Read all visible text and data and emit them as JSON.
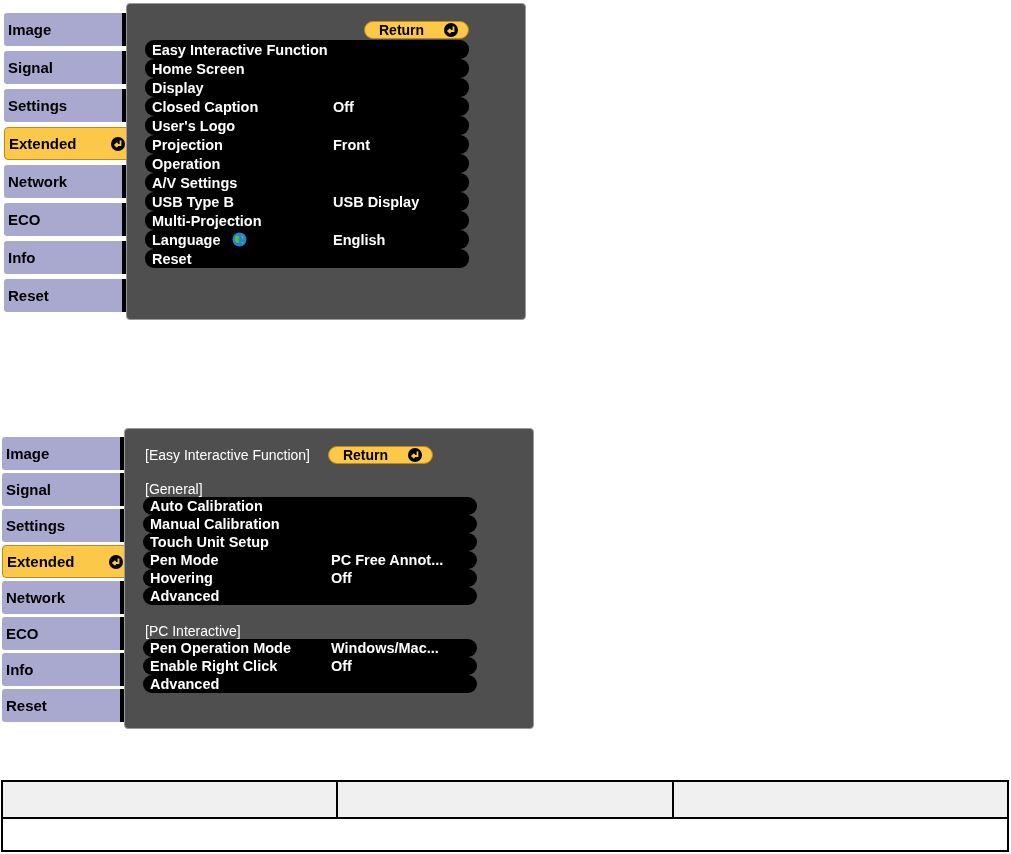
{
  "menus": [
    {
      "sidebar": [
        {
          "label": "Image",
          "selected": false
        },
        {
          "label": "Signal",
          "selected": false
        },
        {
          "label": "Settings",
          "selected": false
        },
        {
          "label": "Extended",
          "selected": true
        },
        {
          "label": "Network",
          "selected": false
        },
        {
          "label": "ECO",
          "selected": false
        },
        {
          "label": "Info",
          "selected": false
        },
        {
          "label": "Reset",
          "selected": false
        }
      ],
      "return_button": "Return",
      "sections": [
        {
          "items": [
            {
              "label": "Easy Interactive Function",
              "globe": false
            },
            {
              "label": "Home Screen",
              "globe": false
            },
            {
              "label": "Display",
              "globe": false
            },
            {
              "label": "Closed Caption",
              "value": "Off",
              "globe": false
            },
            {
              "label": "User's Logo",
              "globe": false
            },
            {
              "label": "Projection",
              "value": "Front",
              "globe": false
            },
            {
              "label": "Operation",
              "globe": false
            },
            {
              "label": "A/V Settings",
              "globe": false
            },
            {
              "label": "USB Type B",
              "value": "USB Display",
              "globe": false
            },
            {
              "label": "Multi-Projection",
              "globe": false
            },
            {
              "label": "Language",
              "value": "English",
              "globe": true
            },
            {
              "label": "Reset",
              "globe": false
            }
          ]
        }
      ]
    },
    {
      "sidebar": [
        {
          "label": "Image",
          "selected": false
        },
        {
          "label": "Signal",
          "selected": false
        },
        {
          "label": "Settings",
          "selected": false
        },
        {
          "label": "Extended",
          "selected": true
        },
        {
          "label": "Network",
          "selected": false
        },
        {
          "label": "ECO",
          "selected": false
        },
        {
          "label": "Info",
          "selected": false
        },
        {
          "label": "Reset",
          "selected": false
        }
      ],
      "title": "[Easy Interactive Function]",
      "return_button": "Return",
      "sections": [
        {
          "heading": "[General]",
          "items": [
            {
              "label": "Auto Calibration",
              "globe": false
            },
            {
              "label": "Manual Calibration",
              "globe": false
            },
            {
              "label": "Touch Unit Setup",
              "globe": false
            },
            {
              "label": "Pen Mode",
              "value": "PC Free Annot...",
              "globe": false
            },
            {
              "label": "Hovering",
              "value": "Off",
              "globe": false
            },
            {
              "label": "Advanced",
              "globe": false
            }
          ]
        },
        {
          "heading": "[PC Interactive]",
          "items": [
            {
              "label": "Pen Operation Mode",
              "value": "Windows/Mac...",
              "globe": false
            },
            {
              "label": "Enable Right Click",
              "value": "Off",
              "globe": false
            },
            {
              "label": "Advanced",
              "globe": false
            }
          ]
        }
      ]
    }
  ]
}
